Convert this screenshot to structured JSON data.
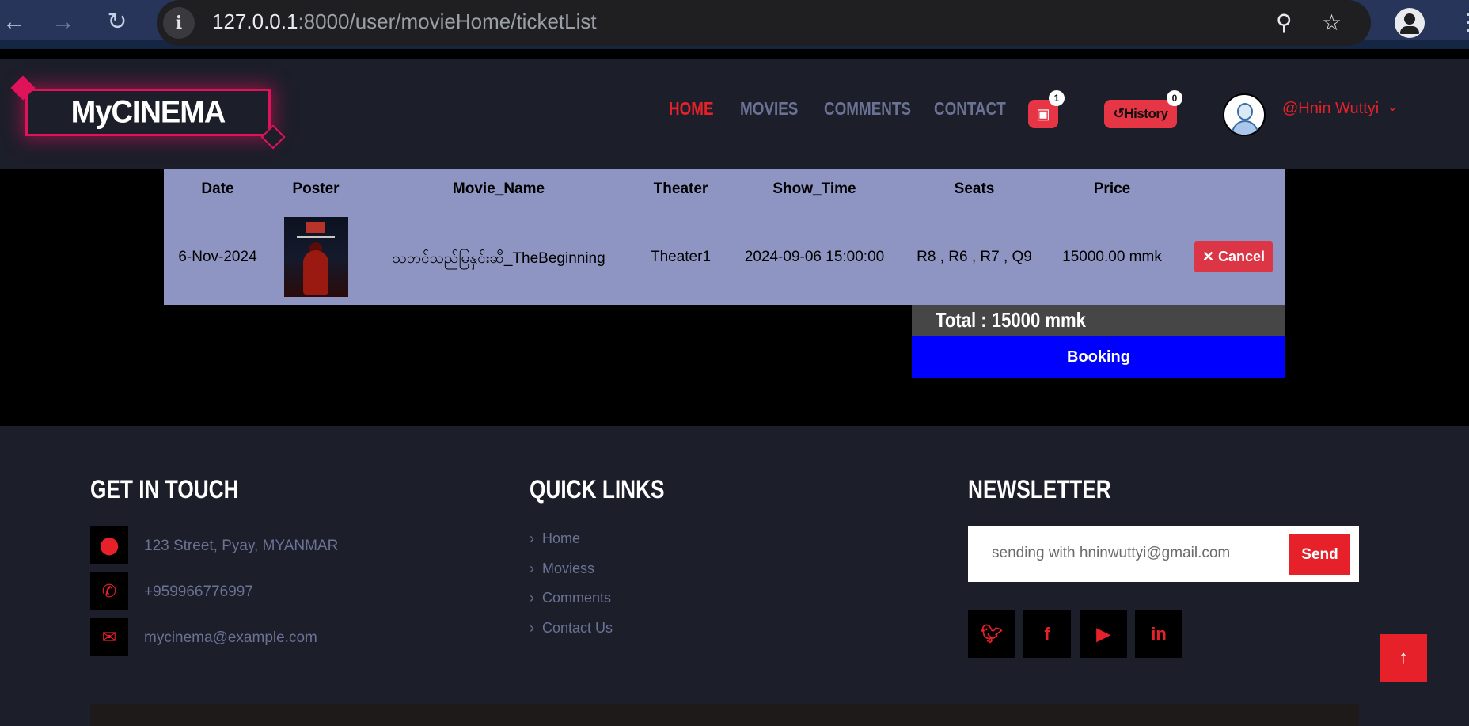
{
  "browser": {
    "back_icon": "arrow-left-icon",
    "forward_icon": "arrow-right-icon",
    "reload_icon": "reload-icon",
    "url_host": "127.0.0.1",
    "url_rest": ":8000/user/movieHome/ticketList",
    "info_glyph": "i"
  },
  "header": {
    "logo_text": "MyCINEMA",
    "nav": [
      "HOME",
      "MOVIES",
      "COMMENTS",
      "CONTACT"
    ],
    "active_nav": "HOME",
    "cart_count": "1",
    "history_label": "History",
    "history_count": "0",
    "user_name": "@Hnin Wuttyi"
  },
  "tickets": {
    "columns": [
      "Date",
      "Poster",
      "Movie_Name",
      "Theater",
      "Show_Time",
      "Seats",
      "Price"
    ],
    "rows": [
      {
        "date": "6-Nov-2024",
        "movie_name": "သဘင်သည်မြနှင်းဆီ_TheBeginning",
        "theater": "Theater1",
        "show_time": "2024-09-06 15:00:00",
        "seats": "R8 , R6 , R7 , Q9",
        "price": "15000.00 mmk",
        "cancel_label": "Cancel"
      }
    ],
    "total_label": "Total : 15000 mmk",
    "booking_label": "Booking"
  },
  "footer": {
    "get_in_touch": {
      "heading": "GET IN TOUCH",
      "address": "123 Street, Pyay, MYANMAR",
      "phone": "+959966776997",
      "email": "mycinema@example.com"
    },
    "quick_links": {
      "heading": "QUICK LINKS",
      "links": [
        "Home",
        "Moviess",
        "Comments",
        "Contact Us"
      ]
    },
    "newsletter": {
      "heading": "NEWSLETTER",
      "input_text": "sending with hninwuttyi@gmail.com",
      "send_label": "Send"
    },
    "social": [
      "twitter-icon",
      "facebook-icon",
      "youtube-icon",
      "linkedin-icon"
    ]
  },
  "colors": {
    "accent": "#e7212a",
    "table_bg": "#8f95c2",
    "booking_bg": "#0000ff",
    "header_bg": "#1c1e2a"
  }
}
